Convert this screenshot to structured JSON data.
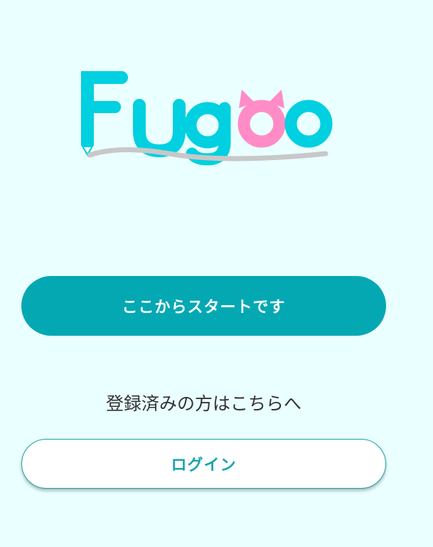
{
  "logo": {
    "text": "Fugoo",
    "colors": {
      "primary": "#00d0e0",
      "accent": "#ff8cc6",
      "underline": "#c8c8c8"
    }
  },
  "start_button": {
    "label": "ここからスタートです"
  },
  "registered_prompt": "登録済みの方はこちらへ",
  "login_button": {
    "label": "ログイン"
  },
  "colors": {
    "background": "#eaffff",
    "primary_button": "#04a8b3",
    "login_text": "#1aa3ad"
  }
}
